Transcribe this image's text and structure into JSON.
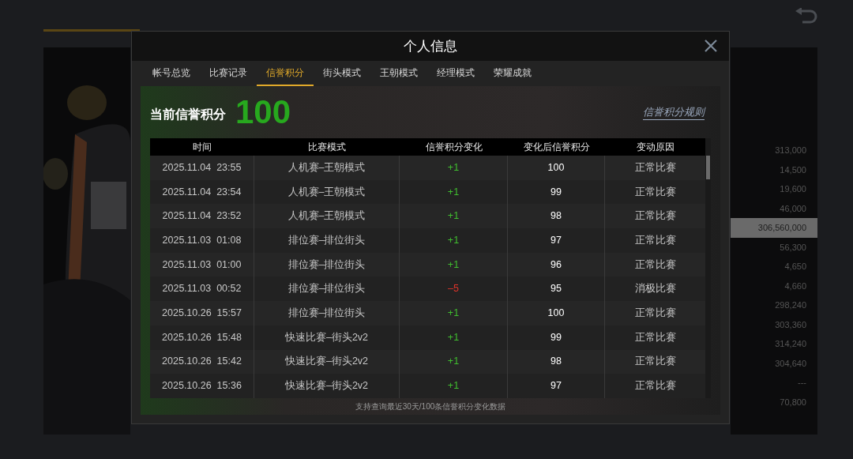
{
  "background": {
    "side_values": [
      {
        "value": "313,000",
        "selected": false
      },
      {
        "value": "14,500",
        "selected": false
      },
      {
        "value": "19,600",
        "selected": false
      },
      {
        "value": "46,000",
        "selected": false
      },
      {
        "value": "306,560,000",
        "selected": true
      },
      {
        "value": "56,300",
        "selected": false
      },
      {
        "value": "4,650",
        "selected": false
      },
      {
        "value": "4,660",
        "selected": false
      },
      {
        "value": "298,240",
        "selected": false
      },
      {
        "value": "303,360",
        "selected": false
      },
      {
        "value": "314,240",
        "selected": false
      },
      {
        "value": "304,640",
        "selected": false
      },
      {
        "value": "---",
        "selected": false
      },
      {
        "value": "70,800",
        "selected": false
      }
    ]
  },
  "dialog": {
    "title": "个人信息",
    "tabs": [
      {
        "label": "帐号总览",
        "selected": false
      },
      {
        "label": "比赛记录",
        "selected": false
      },
      {
        "label": "信誉积分",
        "selected": true
      },
      {
        "label": "街头模式",
        "selected": false
      },
      {
        "label": "王朝模式",
        "selected": false
      },
      {
        "label": "经理模式",
        "selected": false
      },
      {
        "label": "荣耀成就",
        "selected": false
      }
    ],
    "score_label": "当前信誉积分",
    "score": "100",
    "rules_link": "信誉积分规则",
    "table": {
      "columns": [
        "时间",
        "比赛模式",
        "信誉积分变化",
        "变化后信誉积分",
        "变动原因"
      ],
      "rows": [
        {
          "time": "2025.11.04  23:55",
          "mode": "人机赛–王朝模式",
          "change": "+1",
          "color": "#3fbf2f",
          "after": "100",
          "reason": "正常比赛"
        },
        {
          "time": "2025.11.04  23:54",
          "mode": "人机赛–王朝模式",
          "change": "+1",
          "color": "#3fbf2f",
          "after": "99",
          "reason": "正常比赛"
        },
        {
          "time": "2025.11.04  23:52",
          "mode": "人机赛–王朝模式",
          "change": "+1",
          "color": "#3fbf2f",
          "after": "98",
          "reason": "正常比赛"
        },
        {
          "time": "2025.11.03  01:08",
          "mode": "排位赛–排位街头",
          "change": "+1",
          "color": "#3fbf2f",
          "after": "97",
          "reason": "正常比赛"
        },
        {
          "time": "2025.11.03  01:00",
          "mode": "排位赛–排位街头",
          "change": "+1",
          "color": "#3fbf2f",
          "after": "96",
          "reason": "正常比赛"
        },
        {
          "time": "2025.11.03  00:52",
          "mode": "排位赛–排位街头",
          "change": "–5",
          "color": "#e0342a",
          "after": "95",
          "reason": "消极比赛"
        },
        {
          "time": "2025.10.26  15:57",
          "mode": "排位赛–排位街头",
          "change": "+1",
          "color": "#3fbf2f",
          "after": "100",
          "reason": "正常比赛"
        },
        {
          "time": "2025.10.26  15:48",
          "mode": "快速比赛–街头2v2",
          "change": "+1",
          "color": "#3fbf2f",
          "after": "99",
          "reason": "正常比赛"
        },
        {
          "time": "2025.10.26  15:42",
          "mode": "快速比赛–街头2v2",
          "change": "+1",
          "color": "#3fbf2f",
          "after": "98",
          "reason": "正常比赛"
        },
        {
          "time": "2025.10.26  15:36",
          "mode": "快速比赛–街头2v2",
          "change": "+1",
          "color": "#3fbf2f",
          "after": "97",
          "reason": "正常比赛"
        }
      ]
    },
    "footer_note": "支持查询最近30天/100条信誉积分变化数据"
  }
}
